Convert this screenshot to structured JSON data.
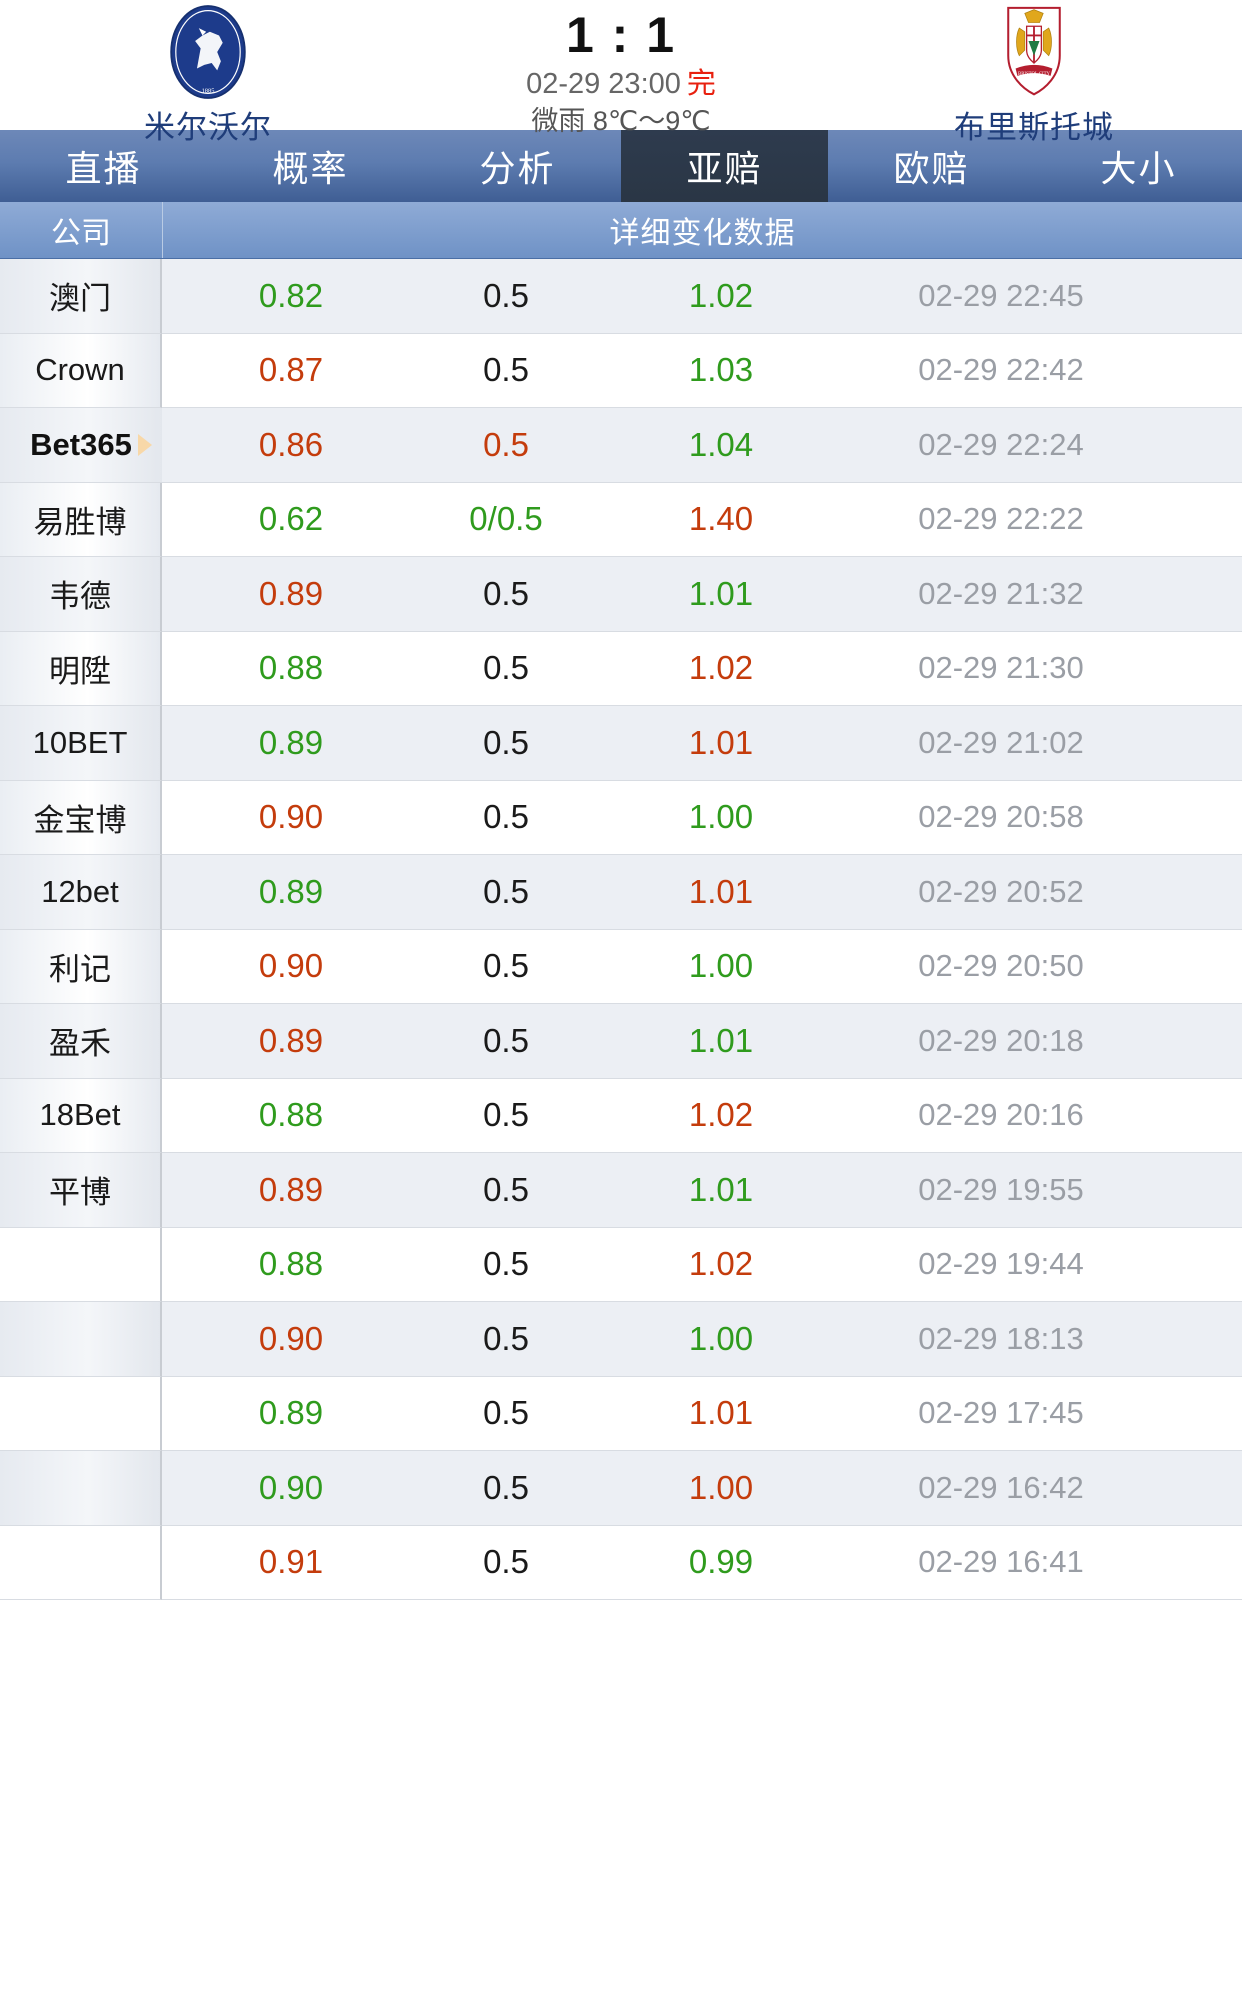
{
  "header": {
    "home_team": "米尔沃尔",
    "away_team": "布里斯托城",
    "home_crest_icon": "millwall-crest-icon",
    "away_crest_icon": "bristol-city-crest-icon",
    "score": "1 : 1",
    "kickoff": "02-29 23:00",
    "status": "完",
    "weather": "微雨 8℃～9℃"
  },
  "tabs": [
    {
      "label": "直播",
      "active": false
    },
    {
      "label": "概率",
      "active": false
    },
    {
      "label": "分析",
      "active": false
    },
    {
      "label": "亚赔",
      "active": true
    },
    {
      "label": "欧赔",
      "active": false
    },
    {
      "label": "大小",
      "active": false
    }
  ],
  "subheader": {
    "company_label": "公司",
    "detail_label": "详细变化数据"
  },
  "colors": {
    "green": "#2f9b1d",
    "red": "#c43c0c",
    "black": "#1a1a1a",
    "gray": "#9a9ea5",
    "highlight_orange": "#e9651a",
    "tab_bar_blue": "#5d7cb0",
    "tab_active": "#2e3b4e",
    "subheader_blue": "#7b9ccb",
    "team_name_blue": "#1f3d7a"
  },
  "rows": [
    {
      "company": "澳门",
      "home": "0.82",
      "home_color": "green",
      "hcp": "0.5",
      "hcp_color": "black",
      "away": "1.02",
      "away_color": "green",
      "time": "02-29 22:45",
      "highlight": false,
      "alt": true
    },
    {
      "company": "Crown",
      "home": "0.87",
      "home_color": "red",
      "hcp": "0.5",
      "hcp_color": "black",
      "away": "1.03",
      "away_color": "green",
      "time": "02-29 22:42",
      "highlight": false,
      "alt": false
    },
    {
      "company": "Bet365",
      "home": "0.86",
      "home_color": "red",
      "hcp": "0.5",
      "hcp_color": "red",
      "away": "1.04",
      "away_color": "green",
      "time": "02-29 22:24",
      "highlight": true,
      "alt": true
    },
    {
      "company": "易胜博",
      "home": "0.62",
      "home_color": "green",
      "hcp": "0/0.5",
      "hcp_color": "green",
      "away": "1.40",
      "away_color": "red",
      "time": "02-29 22:22",
      "highlight": false,
      "alt": false
    },
    {
      "company": "韦德",
      "home": "0.89",
      "home_color": "red",
      "hcp": "0.5",
      "hcp_color": "black",
      "away": "1.01",
      "away_color": "green",
      "time": "02-29 21:32",
      "highlight": false,
      "alt": true
    },
    {
      "company": "明陞",
      "home": "0.88",
      "home_color": "green",
      "hcp": "0.5",
      "hcp_color": "black",
      "away": "1.02",
      "away_color": "red",
      "time": "02-29 21:30",
      "highlight": false,
      "alt": false
    },
    {
      "company": "10BET",
      "home": "0.89",
      "home_color": "green",
      "hcp": "0.5",
      "hcp_color": "black",
      "away": "1.01",
      "away_color": "red",
      "time": "02-29 21:02",
      "highlight": false,
      "alt": true
    },
    {
      "company": "金宝博",
      "home": "0.90",
      "home_color": "red",
      "hcp": "0.5",
      "hcp_color": "black",
      "away": "1.00",
      "away_color": "green",
      "time": "02-29 20:58",
      "highlight": false,
      "alt": false
    },
    {
      "company": "12bet",
      "home": "0.89",
      "home_color": "green",
      "hcp": "0.5",
      "hcp_color": "black",
      "away": "1.01",
      "away_color": "red",
      "time": "02-29 20:52",
      "highlight": false,
      "alt": true
    },
    {
      "company": "利记",
      "home": "0.90",
      "home_color": "red",
      "hcp": "0.5",
      "hcp_color": "black",
      "away": "1.00",
      "away_color": "green",
      "time": "02-29 20:50",
      "highlight": false,
      "alt": false
    },
    {
      "company": "盈禾",
      "home": "0.89",
      "home_color": "red",
      "hcp": "0.5",
      "hcp_color": "black",
      "away": "1.01",
      "away_color": "green",
      "time": "02-29 20:18",
      "highlight": false,
      "alt": true
    },
    {
      "company": "18Bet",
      "home": "0.88",
      "home_color": "green",
      "hcp": "0.5",
      "hcp_color": "black",
      "away": "1.02",
      "away_color": "red",
      "time": "02-29 20:16",
      "highlight": false,
      "alt": false
    },
    {
      "company": "平博",
      "home": "0.89",
      "home_color": "red",
      "hcp": "0.5",
      "hcp_color": "black",
      "away": "1.01",
      "away_color": "green",
      "time": "02-29 19:55",
      "highlight": false,
      "alt": true
    },
    {
      "company": "",
      "home": "0.88",
      "home_color": "green",
      "hcp": "0.5",
      "hcp_color": "black",
      "away": "1.02",
      "away_color": "red",
      "time": "02-29 19:44",
      "highlight": false,
      "alt": false
    },
    {
      "company": "",
      "home": "0.90",
      "home_color": "red",
      "hcp": "0.5",
      "hcp_color": "black",
      "away": "1.00",
      "away_color": "green",
      "time": "02-29 18:13",
      "highlight": false,
      "alt": true
    },
    {
      "company": "",
      "home": "0.89",
      "home_color": "green",
      "hcp": "0.5",
      "hcp_color": "black",
      "away": "1.01",
      "away_color": "red",
      "time": "02-29 17:45",
      "highlight": false,
      "alt": false
    },
    {
      "company": "",
      "home": "0.90",
      "home_color": "green",
      "hcp": "0.5",
      "hcp_color": "black",
      "away": "1.00",
      "away_color": "red",
      "time": "02-29 16:42",
      "highlight": false,
      "alt": true
    },
    {
      "company": "",
      "home": "0.91",
      "home_color": "red",
      "hcp": "0.5",
      "hcp_color": "black",
      "away": "0.99",
      "away_color": "green",
      "time": "02-29 16:41",
      "highlight": false,
      "alt": false
    }
  ]
}
